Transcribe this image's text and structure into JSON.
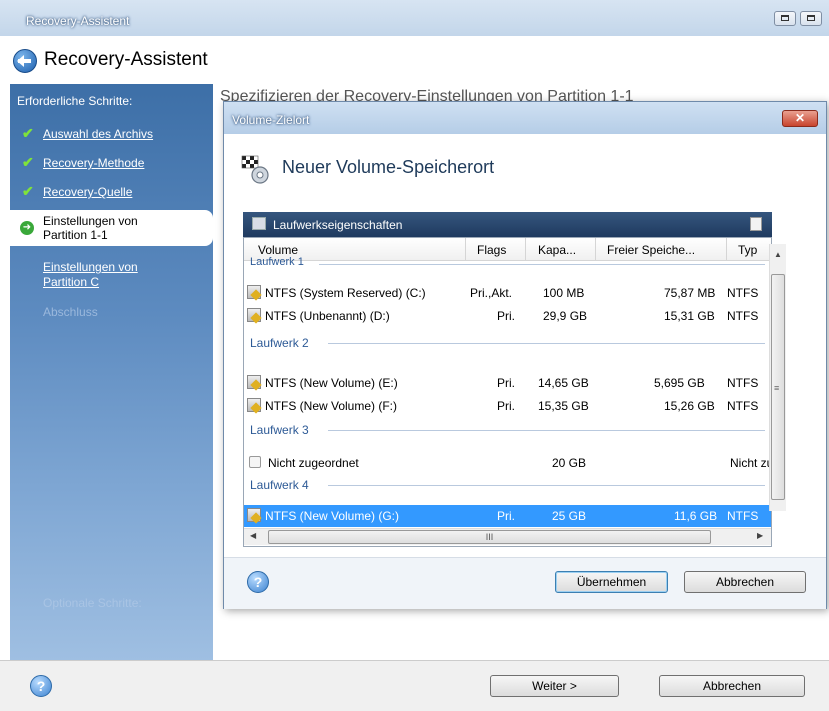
{
  "window": {
    "title": "Recovery-Assistent",
    "header_title": "Recovery-Assistent"
  },
  "sidebar": {
    "heading": "Erforderliche Schritte:",
    "steps": [
      {
        "label": "Auswahl des Archivs",
        "state": "done"
      },
      {
        "label": "Recovery-Methode",
        "state": "done"
      },
      {
        "label": "Recovery-Quelle",
        "state": "done"
      },
      {
        "label": "Einstellungen von Partition 1-1",
        "state": "active"
      },
      {
        "label": "Einstellungen von Partition C",
        "state": "pending"
      },
      {
        "label": "Abschluss",
        "state": "disabled"
      }
    ],
    "optional_heading": "Optionale Schritte:"
  },
  "content": {
    "heading_partial": "Spezifizieren der Recovery-Einstellungen von Partition 1-1"
  },
  "footer": {
    "next_label": "Weiter >",
    "cancel_label": "Abbrechen"
  },
  "dialog": {
    "title": "Volume-Zielort",
    "close_label": "✕",
    "heading": "Neuer Volume-Speicherort",
    "panel_title": "Laufwerkseigenschaften",
    "columns": [
      "Volume",
      "Flags",
      "Kapa...",
      "Freier Speiche...",
      "Typ"
    ],
    "groups": [
      {
        "label": "Laufwerk 1",
        "rows": [
          {
            "volume": "NTFS (System Reserved) (C:)",
            "flags": "Pri.,Akt.",
            "capacity": "100 MB",
            "free": "75,87 MB",
            "type": "NTFS"
          },
          {
            "volume": "NTFS (Unbenannt) (D:)",
            "flags": "Pri.",
            "capacity": "29,9 GB",
            "free": "15,31 GB",
            "type": "NTFS"
          }
        ]
      },
      {
        "label": "Laufwerk 2",
        "rows": [
          {
            "volume": "NTFS (New Volume) (E:)",
            "flags": "Pri.",
            "capacity": "14,65 GB",
            "free": "5,695 GB",
            "type": "NTFS"
          },
          {
            "volume": "NTFS (New Volume) (F:)",
            "flags": "Pri.",
            "capacity": "15,35 GB",
            "free": "15,26 GB",
            "type": "NTFS"
          }
        ]
      },
      {
        "label": "Laufwerk 3",
        "rows": [
          {
            "volume": "Nicht zugeordnet",
            "flags": "",
            "capacity": "20 GB",
            "free": "",
            "type": "Nicht zug"
          }
        ]
      },
      {
        "label": "Laufwerk 4",
        "rows": [
          {
            "volume": "NTFS (New Volume) (G:)",
            "flags": "Pri.",
            "capacity": "25 GB",
            "free": "11,6 GB",
            "type": "NTFS",
            "selected": true
          }
        ]
      }
    ],
    "hscroll_grip": "III",
    "ok_label": "Übernehmen",
    "cancel_label": "Abbrechen"
  },
  "icons": {
    "back": "back-arrow-icon",
    "help": "help-icon",
    "check": "checkmark-icon",
    "disk_volume": "volume-icon"
  }
}
